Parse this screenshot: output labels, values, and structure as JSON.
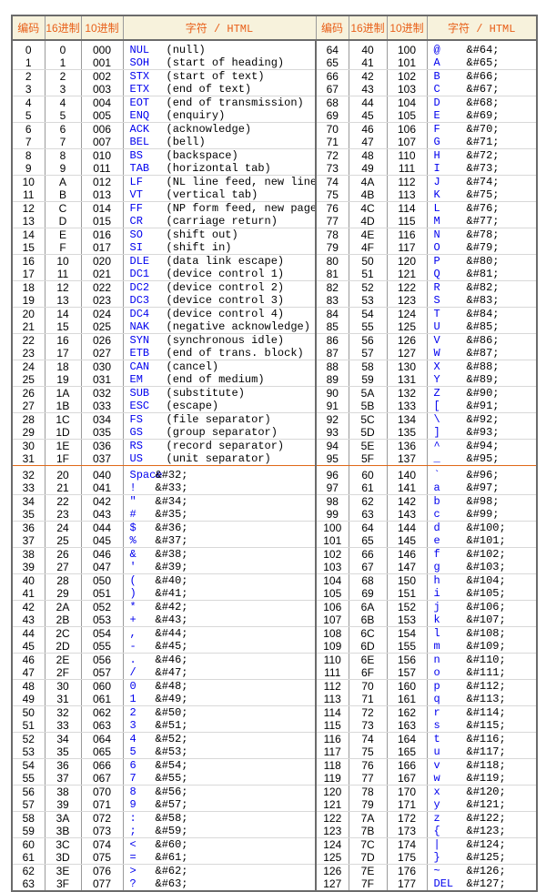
{
  "header": {
    "code": "编码",
    "hex": "16进制",
    "oct": "10进制",
    "char": "字符 / HTML"
  },
  "colors": {
    "header_text": "#e8601a",
    "header_bg": "#f7f2dc",
    "symbol": "#0000ee",
    "divider": "#e06818"
  },
  "left": [
    [
      "0",
      "0",
      "000",
      "NUL",
      "(null)"
    ],
    [
      "1",
      "1",
      "001",
      "SOH",
      "(start of heading)"
    ],
    [
      "2",
      "2",
      "002",
      "STX",
      "(start of text)"
    ],
    [
      "3",
      "3",
      "003",
      "ETX",
      "(end of text)"
    ],
    [
      "4",
      "4",
      "004",
      "EOT",
      "(end of transmission)"
    ],
    [
      "5",
      "5",
      "005",
      "ENQ",
      "(enquiry)"
    ],
    [
      "6",
      "6",
      "006",
      "ACK",
      "(acknowledge)"
    ],
    [
      "7",
      "7",
      "007",
      "BEL",
      "(bell)"
    ],
    [
      "8",
      "8",
      "010",
      "BS",
      "(backspace)"
    ],
    [
      "9",
      "9",
      "011",
      "TAB",
      "(horizontal tab)"
    ],
    [
      "10",
      "A",
      "012",
      "LF",
      "(NL line feed, new line)"
    ],
    [
      "11",
      "B",
      "013",
      "VT",
      "(vertical tab)"
    ],
    [
      "12",
      "C",
      "014",
      "FF",
      "(NP form feed, new page)"
    ],
    [
      "13",
      "D",
      "015",
      "CR",
      "(carriage return)"
    ],
    [
      "14",
      "E",
      "016",
      "SO",
      "(shift out)"
    ],
    [
      "15",
      "F",
      "017",
      "SI",
      "(shift in)"
    ],
    [
      "16",
      "10",
      "020",
      "DLE",
      "(data link escape)"
    ],
    [
      "17",
      "11",
      "021",
      "DC1",
      "(device control 1)"
    ],
    [
      "18",
      "12",
      "022",
      "DC2",
      "(device control 2)"
    ],
    [
      "19",
      "13",
      "023",
      "DC3",
      "(device control 3)"
    ],
    [
      "20",
      "14",
      "024",
      "DC4",
      "(device control 4)"
    ],
    [
      "21",
      "15",
      "025",
      "NAK",
      "(negative acknowledge)"
    ],
    [
      "22",
      "16",
      "026",
      "SYN",
      "(synchronous idle)"
    ],
    [
      "23",
      "17",
      "027",
      "ETB",
      "(end of trans. block)"
    ],
    [
      "24",
      "18",
      "030",
      "CAN",
      "(cancel)"
    ],
    [
      "25",
      "19",
      "031",
      "EM",
      "(end of medium)"
    ],
    [
      "26",
      "1A",
      "032",
      "SUB",
      "(substitute)"
    ],
    [
      "27",
      "1B",
      "033",
      "ESC",
      "(escape)"
    ],
    [
      "28",
      "1C",
      "034",
      "FS",
      "(file separator)"
    ],
    [
      "29",
      "1D",
      "035",
      "GS",
      "(group separator)"
    ],
    [
      "30",
      "1E",
      "036",
      "RS",
      "(record separator)"
    ],
    [
      "31",
      "1F",
      "037",
      "US",
      "(unit separator)"
    ],
    [
      "32",
      "20",
      "040",
      "Space",
      "&#32;"
    ],
    [
      "33",
      "21",
      "041",
      "!",
      "&#33;"
    ],
    [
      "34",
      "22",
      "042",
      "\"",
      "&#34;"
    ],
    [
      "35",
      "23",
      "043",
      "#",
      "&#35;"
    ],
    [
      "36",
      "24",
      "044",
      "$",
      "&#36;"
    ],
    [
      "37",
      "25",
      "045",
      "%",
      "&#37;"
    ],
    [
      "38",
      "26",
      "046",
      "&",
      "&#38;"
    ],
    [
      "39",
      "27",
      "047",
      "'",
      "&#39;"
    ],
    [
      "40",
      "28",
      "050",
      "(",
      "&#40;"
    ],
    [
      "41",
      "29",
      "051",
      ")",
      "&#41;"
    ],
    [
      "42",
      "2A",
      "052",
      "*",
      "&#42;"
    ],
    [
      "43",
      "2B",
      "053",
      "+",
      "&#43;"
    ],
    [
      "44",
      "2C",
      "054",
      ",",
      "&#44;"
    ],
    [
      "45",
      "2D",
      "055",
      "-",
      "&#45;"
    ],
    [
      "46",
      "2E",
      "056",
      ".",
      "&#46;"
    ],
    [
      "47",
      "2F",
      "057",
      "/",
      "&#47;"
    ],
    [
      "48",
      "30",
      "060",
      "0",
      "&#48;"
    ],
    [
      "49",
      "31",
      "061",
      "1",
      "&#49;"
    ],
    [
      "50",
      "32",
      "062",
      "2",
      "&#50;"
    ],
    [
      "51",
      "33",
      "063",
      "3",
      "&#51;"
    ],
    [
      "52",
      "34",
      "064",
      "4",
      "&#52;"
    ],
    [
      "53",
      "35",
      "065",
      "5",
      "&#53;"
    ],
    [
      "54",
      "36",
      "066",
      "6",
      "&#54;"
    ],
    [
      "55",
      "37",
      "067",
      "7",
      "&#55;"
    ],
    [
      "56",
      "38",
      "070",
      "8",
      "&#56;"
    ],
    [
      "57",
      "39",
      "071",
      "9",
      "&#57;"
    ],
    [
      "58",
      "3A",
      "072",
      ":",
      "&#58;"
    ],
    [
      "59",
      "3B",
      "073",
      ";",
      "&#59;"
    ],
    [
      "60",
      "3C",
      "074",
      "<",
      "&#60;"
    ],
    [
      "61",
      "3D",
      "075",
      "=",
      "&#61;"
    ],
    [
      "62",
      "3E",
      "076",
      ">",
      "&#62;"
    ],
    [
      "63",
      "3F",
      "077",
      "?",
      "&#63;"
    ]
  ],
  "right": [
    [
      "64",
      "40",
      "100",
      "@",
      "&#64;"
    ],
    [
      "65",
      "41",
      "101",
      "A",
      "&#65;"
    ],
    [
      "66",
      "42",
      "102",
      "B",
      "&#66;"
    ],
    [
      "67",
      "43",
      "103",
      "C",
      "&#67;"
    ],
    [
      "68",
      "44",
      "104",
      "D",
      "&#68;"
    ],
    [
      "69",
      "45",
      "105",
      "E",
      "&#69;"
    ],
    [
      "70",
      "46",
      "106",
      "F",
      "&#70;"
    ],
    [
      "71",
      "47",
      "107",
      "G",
      "&#71;"
    ],
    [
      "72",
      "48",
      "110",
      "H",
      "&#72;"
    ],
    [
      "73",
      "49",
      "111",
      "I",
      "&#73;"
    ],
    [
      "74",
      "4A",
      "112",
      "J",
      "&#74;"
    ],
    [
      "75",
      "4B",
      "113",
      "K",
      "&#75;"
    ],
    [
      "76",
      "4C",
      "114",
      "L",
      "&#76;"
    ],
    [
      "77",
      "4D",
      "115",
      "M",
      "&#77;"
    ],
    [
      "78",
      "4E",
      "116",
      "N",
      "&#78;"
    ],
    [
      "79",
      "4F",
      "117",
      "O",
      "&#79;"
    ],
    [
      "80",
      "50",
      "120",
      "P",
      "&#80;"
    ],
    [
      "81",
      "51",
      "121",
      "Q",
      "&#81;"
    ],
    [
      "82",
      "52",
      "122",
      "R",
      "&#82;"
    ],
    [
      "83",
      "53",
      "123",
      "S",
      "&#83;"
    ],
    [
      "84",
      "54",
      "124",
      "T",
      "&#84;"
    ],
    [
      "85",
      "55",
      "125",
      "U",
      "&#85;"
    ],
    [
      "86",
      "56",
      "126",
      "V",
      "&#86;"
    ],
    [
      "87",
      "57",
      "127",
      "W",
      "&#87;"
    ],
    [
      "88",
      "58",
      "130",
      "X",
      "&#88;"
    ],
    [
      "89",
      "59",
      "131",
      "Y",
      "&#89;"
    ],
    [
      "90",
      "5A",
      "132",
      "Z",
      "&#90;"
    ],
    [
      "91",
      "5B",
      "133",
      "[",
      "&#91;"
    ],
    [
      "92",
      "5C",
      "134",
      "\\",
      "&#92;"
    ],
    [
      "93",
      "5D",
      "135",
      "]",
      "&#93;"
    ],
    [
      "94",
      "5E",
      "136",
      "^",
      "&#94;"
    ],
    [
      "95",
      "5F",
      "137",
      "_",
      "&#95;"
    ],
    [
      "96",
      "60",
      "140",
      "`",
      "&#96;"
    ],
    [
      "97",
      "61",
      "141",
      "a",
      "&#97;"
    ],
    [
      "98",
      "62",
      "142",
      "b",
      "&#98;"
    ],
    [
      "99",
      "63",
      "143",
      "c",
      "&#99;"
    ],
    [
      "100",
      "64",
      "144",
      "d",
      "&#100;"
    ],
    [
      "101",
      "65",
      "145",
      "e",
      "&#101;"
    ],
    [
      "102",
      "66",
      "146",
      "f",
      "&#102;"
    ],
    [
      "103",
      "67",
      "147",
      "g",
      "&#103;"
    ],
    [
      "104",
      "68",
      "150",
      "h",
      "&#104;"
    ],
    [
      "105",
      "69",
      "151",
      "i",
      "&#105;"
    ],
    [
      "106",
      "6A",
      "152",
      "j",
      "&#106;"
    ],
    [
      "107",
      "6B",
      "153",
      "k",
      "&#107;"
    ],
    [
      "108",
      "6C",
      "154",
      "l",
      "&#108;"
    ],
    [
      "109",
      "6D",
      "155",
      "m",
      "&#109;"
    ],
    [
      "110",
      "6E",
      "156",
      "n",
      "&#110;"
    ],
    [
      "111",
      "6F",
      "157",
      "o",
      "&#111;"
    ],
    [
      "112",
      "70",
      "160",
      "p",
      "&#112;"
    ],
    [
      "113",
      "71",
      "161",
      "q",
      "&#113;"
    ],
    [
      "114",
      "72",
      "162",
      "r",
      "&#114;"
    ],
    [
      "115",
      "73",
      "163",
      "s",
      "&#115;"
    ],
    [
      "116",
      "74",
      "164",
      "t",
      "&#116;"
    ],
    [
      "117",
      "75",
      "165",
      "u",
      "&#117;"
    ],
    [
      "118",
      "76",
      "166",
      "v",
      "&#118;"
    ],
    [
      "119",
      "77",
      "167",
      "w",
      "&#119;"
    ],
    [
      "120",
      "78",
      "170",
      "x",
      "&#120;"
    ],
    [
      "121",
      "79",
      "171",
      "y",
      "&#121;"
    ],
    [
      "122",
      "7A",
      "172",
      "z",
      "&#122;"
    ],
    [
      "123",
      "7B",
      "173",
      "{",
      "&#123;"
    ],
    [
      "124",
      "7C",
      "174",
      "|",
      "&#124;"
    ],
    [
      "125",
      "7D",
      "175",
      "}",
      "&#125;"
    ],
    [
      "126",
      "7E",
      "176",
      "~",
      "&#126;"
    ],
    [
      "127",
      "7F",
      "177",
      "DEL",
      "&#127;"
    ]
  ]
}
